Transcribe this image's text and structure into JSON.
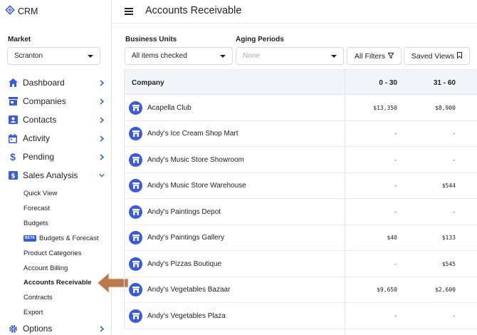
{
  "app": {
    "name": "CRM"
  },
  "market": {
    "label": "Market",
    "value": "Scranton"
  },
  "nav": {
    "items": [
      {
        "label": "Dashboard",
        "icon": "home-icon",
        "chevron": "right"
      },
      {
        "label": "Companies",
        "icon": "store-icon",
        "chevron": "right"
      },
      {
        "label": "Contacts",
        "icon": "contacts-icon",
        "chevron": "right"
      },
      {
        "label": "Activity",
        "icon": "calendar-icon",
        "chevron": "right"
      },
      {
        "label": "Pending",
        "icon": "dollar-icon",
        "chevron": "right"
      },
      {
        "label": "Sales Analysis",
        "icon": "sales-icon",
        "chevron": "down"
      }
    ],
    "sub_items": [
      {
        "label": "Quick View"
      },
      {
        "label": "Forecast"
      },
      {
        "label": "Budgets"
      },
      {
        "label": "Budgets & Forecast",
        "badge": "BETA"
      },
      {
        "label": "Product Categories"
      },
      {
        "label": "Account Billing"
      },
      {
        "label": "Accounts Receivable",
        "active": true
      },
      {
        "label": "Contracts"
      },
      {
        "label": "Export"
      }
    ],
    "bottom_item": {
      "label": "Options",
      "icon": "gear-icon",
      "chevron": "right"
    }
  },
  "header": {
    "title": "Accounts Receivable"
  },
  "filters": {
    "business_units": {
      "label": "Business Units",
      "value": "All items checked"
    },
    "aging_periods": {
      "label": "Aging Periods",
      "placeholder": "None"
    },
    "all_filters_label": "All Filters",
    "saved_views_label": "Saved Views"
  },
  "table": {
    "columns": [
      "Company",
      "0 - 30",
      "31 - 60"
    ],
    "rows": [
      {
        "company": "Acapella Club",
        "c0_30": "$13,350",
        "c31_60": "$8,900"
      },
      {
        "company": "Andy's Ice Cream Shop Mart",
        "c0_30": "-",
        "c31_60": "-"
      },
      {
        "company": "Andy's Music Store Showroom",
        "c0_30": "-",
        "c31_60": "-"
      },
      {
        "company": "Andy's Music Store Warehouse",
        "c0_30": "-",
        "c31_60": "$544"
      },
      {
        "company": "Andy's Paintings Depot",
        "c0_30": "-",
        "c31_60": "-"
      },
      {
        "company": "Andy's Paintings Gallery",
        "c0_30": "$40",
        "c31_60": "$133"
      },
      {
        "company": "Andy's Pizzas Boutique",
        "c0_30": "-",
        "c31_60": "$545"
      },
      {
        "company": "Andy's Vegetables Bazaar",
        "c0_30": "$9,650",
        "c31_60": "$2,600"
      },
      {
        "company": "Andy's Vegetables Plaza",
        "c0_30": "-",
        "c31_60": "-"
      }
    ]
  },
  "colors": {
    "accent": "#3b5bdb",
    "arrow": "#b87a4b"
  }
}
